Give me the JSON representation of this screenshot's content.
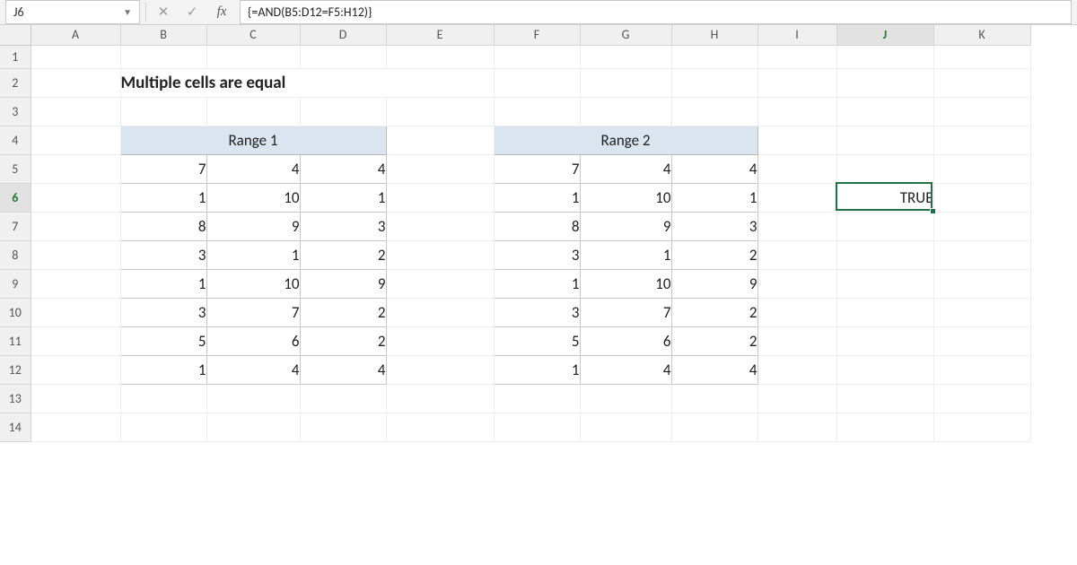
{
  "formula_bar": {
    "cell_ref": "J6",
    "formula": "{=AND(B5:D12=F5:H12)}",
    "fx_label": "fx"
  },
  "columns": [
    "A",
    "B",
    "C",
    "D",
    "E",
    "F",
    "G",
    "H",
    "I",
    "J",
    "K"
  ],
  "rows": [
    "1",
    "2",
    "3",
    "4",
    "5",
    "6",
    "7",
    "8",
    "9",
    "10",
    "11",
    "12",
    "13",
    "14"
  ],
  "active_col": "J",
  "active_row": "6",
  "title": "Multiple cells are equal",
  "range1": {
    "label": "Range 1",
    "data": [
      [
        7,
        4,
        4
      ],
      [
        1,
        10,
        1
      ],
      [
        8,
        9,
        3
      ],
      [
        3,
        1,
        2
      ],
      [
        1,
        10,
        9
      ],
      [
        3,
        7,
        2
      ],
      [
        5,
        6,
        2
      ],
      [
        1,
        4,
        4
      ]
    ]
  },
  "range2": {
    "label": "Range 2",
    "data": [
      [
        7,
        4,
        4
      ],
      [
        1,
        10,
        1
      ],
      [
        8,
        9,
        3
      ],
      [
        3,
        1,
        2
      ],
      [
        1,
        10,
        9
      ],
      [
        3,
        7,
        2
      ],
      [
        5,
        6,
        2
      ],
      [
        1,
        4,
        4
      ]
    ]
  },
  "result": "TRUE"
}
